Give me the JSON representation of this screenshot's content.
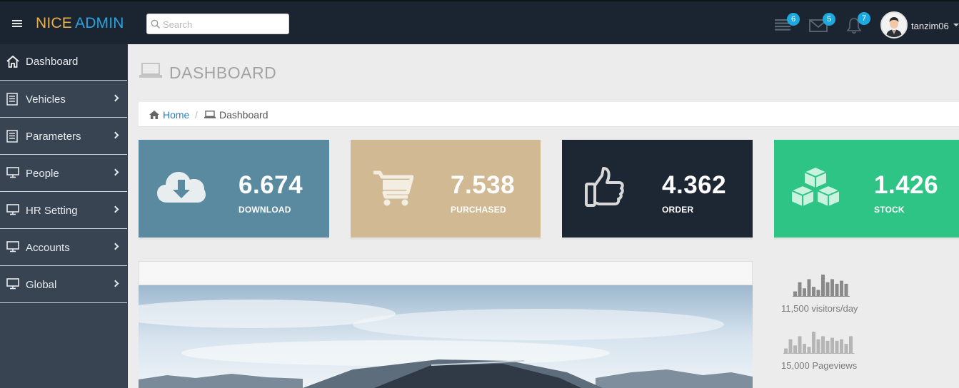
{
  "header": {
    "brand_part1": "NICE",
    "brand_part2": "ADMIN",
    "search_placeholder": "Search",
    "tasks_count": "6",
    "messages_count": "5",
    "notifications_count": "7",
    "username": "tanzim06"
  },
  "sidebar": {
    "items": [
      {
        "label": "Dashboard",
        "icon": "home-icon"
      },
      {
        "label": "Vehicles",
        "icon": "document-icon"
      },
      {
        "label": "Parameters",
        "icon": "document-icon"
      },
      {
        "label": "People",
        "icon": "monitor-icon"
      },
      {
        "label": "HR Setting",
        "icon": "monitor-icon"
      },
      {
        "label": "Accounts",
        "icon": "monitor-icon"
      },
      {
        "label": "Global",
        "icon": "monitor-icon"
      }
    ]
  },
  "page": {
    "title": "DASHBOARD",
    "breadcrumb_home": "Home",
    "breadcrumb_separator": "/",
    "breadcrumb_current": "Dashboard"
  },
  "stats": [
    {
      "value": "6.674",
      "label": "DOWNLOAD",
      "color": "#5a8a9f",
      "icon": "cloud-download-icon"
    },
    {
      "value": "7.538",
      "label": "PURCHASED",
      "color": "#d1b993",
      "icon": "shopping-cart-icon"
    },
    {
      "value": "4.362",
      "label": "ORDER",
      "color": "#1d2633",
      "icon": "thumbs-up-icon"
    },
    {
      "value": "1.426",
      "label": "STOCK",
      "color": "#2ec486",
      "icon": "cubes-icon"
    }
  ],
  "sparklines": [
    {
      "label": "11,500 visitors/day",
      "values": [
        3,
        9,
        5,
        11,
        6,
        4,
        14,
        9,
        11,
        8,
        10,
        8
      ],
      "color": "#8a8a8a"
    },
    {
      "label": "15,000 Pageviews",
      "values": [
        3,
        9,
        5,
        11,
        6,
        4,
        14,
        9,
        11,
        8,
        10,
        8,
        9,
        6,
        11
      ],
      "color": "#b5b5b5"
    }
  ],
  "colors": {
    "header_bg": "#1b2431",
    "sidebar_bg": "#384452",
    "accent_blue": "#1ea8e0",
    "brand_orange": "#e8b04a"
  }
}
